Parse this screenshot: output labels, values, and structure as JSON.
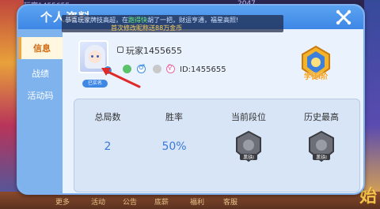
{
  "background": {
    "top_left_text": "玩家1455655",
    "top_right_text": "2047",
    "bottom_tabs": [
      "更多",
      "活动",
      "公告",
      "底薪",
      "福利",
      "客服"
    ],
    "corner_glyph": "始"
  },
  "panel": {
    "title": "个人资料",
    "close_icon": "close-x-icon"
  },
  "marquee": {
    "line1_a": "恭喜玩家",
    "line1_b": "牌技高超，在",
    "line1_highlight": "跑得快",
    "line1_c": "胡了一把",
    "line1_d": "，财运亨通，福星高照!",
    "line2": "首次修改昵称送88万金币"
  },
  "sidebar": {
    "tabs": [
      {
        "label": "信息",
        "active": true
      },
      {
        "label": "战绩",
        "active": false
      },
      {
        "label": "活动码",
        "active": false
      }
    ]
  },
  "profile": {
    "verified_label": "已实名",
    "username": "玩家1455655",
    "uid_label": "ID:1455655",
    "gender_male_symbol": "♂",
    "gender_female_symbol": "♀",
    "rank_badge_label": "学徒I阶"
  },
  "stats": {
    "columns": [
      {
        "header": "总局数",
        "value": "2"
      },
      {
        "header": "胜率",
        "value": "50%"
      },
      {
        "header": "当前段位",
        "badge": "黑铁I",
        "badge_icon": "black-iron-rank-icon"
      },
      {
        "header": "历史最高",
        "badge": "黑铁I",
        "badge_icon": "black-iron-rank-icon"
      }
    ]
  },
  "colors": {
    "accent_blue": "#3e87e6",
    "value_blue": "#3a7ad8",
    "active_tab_text": "#d26a12",
    "rank_gold": "#f5a019",
    "arrow_red": "#e02a2a"
  }
}
